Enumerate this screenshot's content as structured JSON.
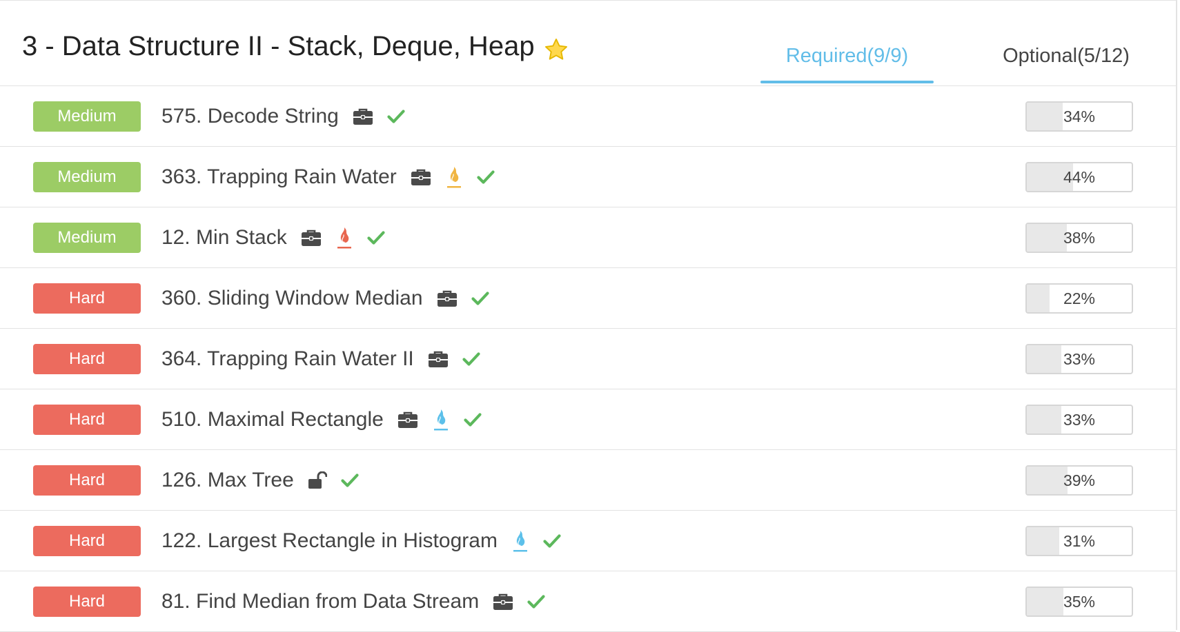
{
  "header": {
    "title": "3 - Data Structure II - Stack, Deque, Heap",
    "star_icon": "star-icon",
    "tabs": {
      "required": "Required(9/9)",
      "optional": "Optional(5/12)"
    },
    "active_tab": "required"
  },
  "colors": {
    "accent": "#62bde8",
    "medium": "#9ccc65",
    "hard": "#ec6b5e",
    "check": "#5cb85c",
    "hot_orange": "#f0b542",
    "hot_red": "#e8664f",
    "hot_blue": "#5cc0ea"
  },
  "problems": [
    {
      "difficulty": "Medium",
      "level": "medium",
      "title": "575. Decode String",
      "icons": [
        "briefcase-icon",
        "check-icon"
      ],
      "rate": "34%",
      "rate_value": 34
    },
    {
      "difficulty": "Medium",
      "level": "medium",
      "title": "363. Trapping Rain Water",
      "icons": [
        "briefcase-icon",
        "flame-orange-icon",
        "check-icon"
      ],
      "rate": "44%",
      "rate_value": 44
    },
    {
      "difficulty": "Medium",
      "level": "medium",
      "title": "12. Min Stack",
      "icons": [
        "briefcase-icon",
        "flame-red-icon",
        "check-icon"
      ],
      "rate": "38%",
      "rate_value": 38
    },
    {
      "difficulty": "Hard",
      "level": "hard",
      "title": "360. Sliding Window Median",
      "icons": [
        "briefcase-icon",
        "check-icon"
      ],
      "rate": "22%",
      "rate_value": 22
    },
    {
      "difficulty": "Hard",
      "level": "hard",
      "title": "364. Trapping Rain Water II",
      "icons": [
        "briefcase-icon",
        "check-icon"
      ],
      "rate": "33%",
      "rate_value": 33
    },
    {
      "difficulty": "Hard",
      "level": "hard",
      "title": "510. Maximal Rectangle",
      "icons": [
        "briefcase-icon",
        "flame-blue-icon",
        "check-icon"
      ],
      "rate": "33%",
      "rate_value": 33
    },
    {
      "difficulty": "Hard",
      "level": "hard",
      "title": "126. Max Tree",
      "icons": [
        "unlock-icon",
        "check-icon"
      ],
      "rate": "39%",
      "rate_value": 39
    },
    {
      "difficulty": "Hard",
      "level": "hard",
      "title": "122. Largest Rectangle in Histogram",
      "icons": [
        "flame-blue-icon",
        "check-icon"
      ],
      "rate": "31%",
      "rate_value": 31
    },
    {
      "difficulty": "Hard",
      "level": "hard",
      "title": "81. Find Median from Data Stream",
      "icons": [
        "briefcase-icon",
        "check-icon"
      ],
      "rate": "35%",
      "rate_value": 35
    }
  ]
}
